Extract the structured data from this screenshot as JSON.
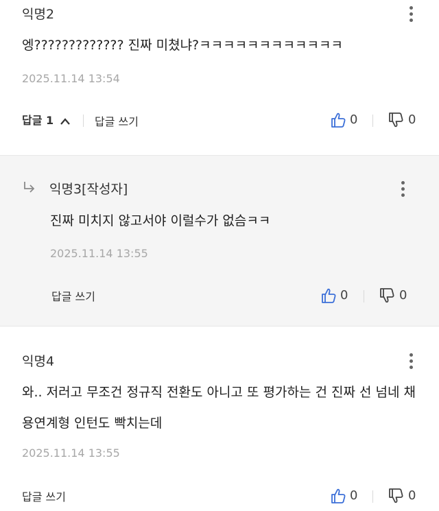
{
  "comments": [
    {
      "author": "익명2",
      "body": "엥????????????? 진짜 미쳤냐?ㅋㅋㅋㅋㅋㅋㅋㅋㅋㅋㅋㅋ",
      "date": "2025.11.14 13:54",
      "replies_label": "답글 1",
      "write_reply": "답글 쓰기",
      "likes": "0",
      "dislikes": "0"
    },
    {
      "author": "익명3[작성자]",
      "body": "진짜 미치지 않고서야 이럴수가 없슴ㅋㅋ",
      "date": "2025.11.14 13:55",
      "write_reply": "답글 쓰기",
      "likes": "0",
      "dislikes": "0"
    },
    {
      "author": "익명4",
      "body": "와.. 저러고 무조건 정규직 전환도 아니고 또 평가하는 건 진짜 선 넘네 채용연계형 인턴도 빡치는데",
      "date": "2025.11.14 13:55",
      "write_reply": "답글 쓰기",
      "likes": "0",
      "dislikes": "0"
    }
  ],
  "icons": {
    "more": "kebab-menu-icon",
    "like": "thumbs-up-icon",
    "dislike": "thumbs-down-icon",
    "reply_arrow": "reply-arrow-icon",
    "collapse": "chevron-up-icon"
  },
  "colors": {
    "like_icon": "#3b6fd8",
    "reply_background": "#f5f5f5",
    "date_text": "#a7a7a7"
  }
}
